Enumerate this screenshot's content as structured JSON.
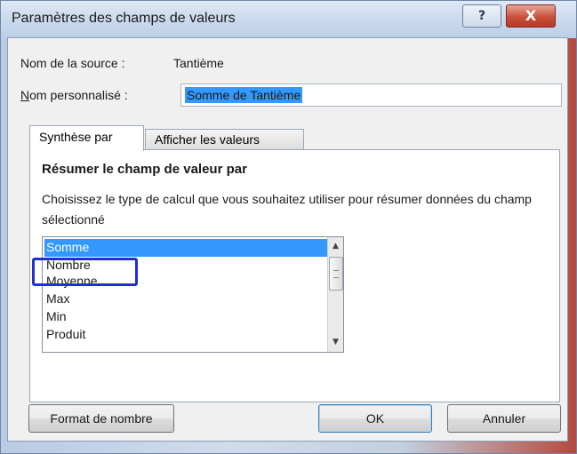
{
  "window": {
    "title": "Paramètres des champs de valeurs",
    "help_label": "?",
    "close_label": "X"
  },
  "source": {
    "label": "Nom de la source :",
    "value": "Tantième"
  },
  "custom_name": {
    "label": "Nom personnalisé :",
    "value": "Somme de Tantième"
  },
  "tabs": [
    {
      "label": "Synthèse par",
      "active": true
    },
    {
      "label": "Afficher les valeurs",
      "active": false
    }
  ],
  "panel": {
    "heading": "Résumer le champ de valeur par",
    "instructions": "Choisissez le type de calcul que vous souhaitez utiliser pour résumer données du champ sélectionné"
  },
  "list": {
    "items": [
      "Somme",
      "Nombre",
      "Moyenne",
      "Max",
      "Min",
      "Produit"
    ],
    "selected": "Somme",
    "highlighted": "Nombre"
  },
  "buttons": {
    "format": "Format de nombre",
    "ok": "OK",
    "cancel": "Annuler"
  },
  "colors": {
    "selection": "#3399ff",
    "highlight_box": "#1f2fd0",
    "close_button": "#c9503b"
  },
  "icons": {
    "scroll_up": "triangle-up",
    "scroll_down": "triangle-down",
    "scroll_grip": "grip"
  }
}
